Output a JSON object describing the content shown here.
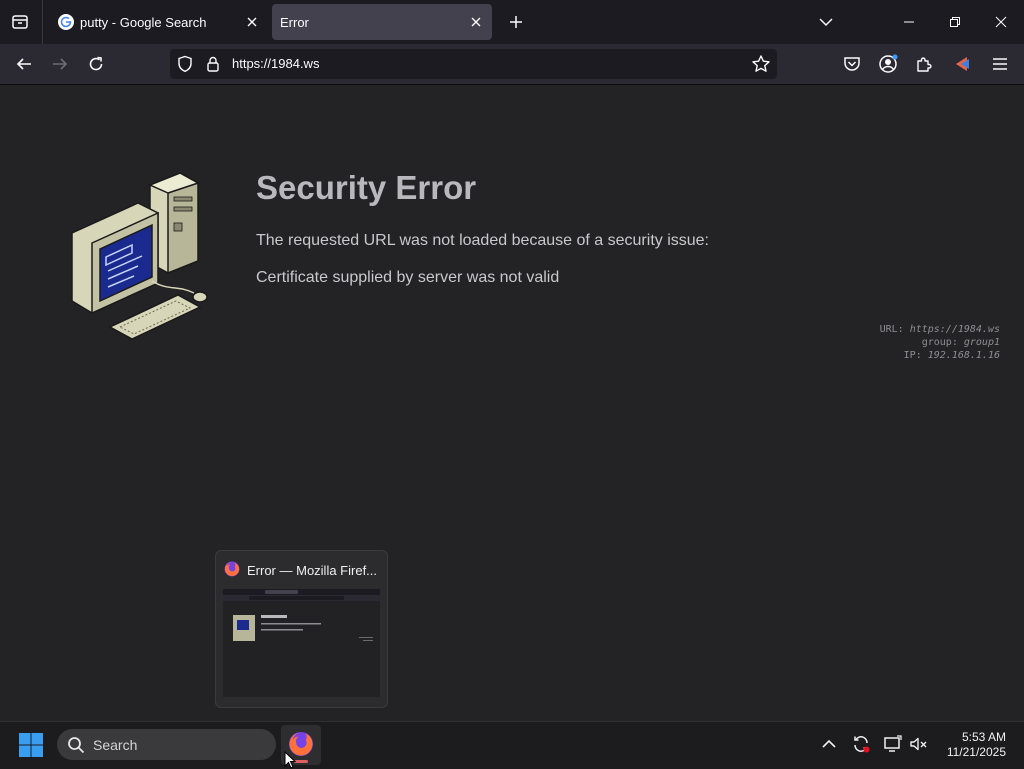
{
  "browser": {
    "tabs": [
      {
        "title": "putty - Google Search",
        "favicon": "google-icon",
        "active": false
      },
      {
        "title": "Error",
        "favicon": "",
        "active": true
      }
    ],
    "url": "https://1984.ws"
  },
  "page": {
    "title": "Security Error",
    "message": "The requested URL was not loaded because of a security issue:",
    "detail": "Certificate supplied by server was not valid",
    "meta": {
      "url_label": "URL:",
      "url_value": "https://1984.ws",
      "group_label": "group:",
      "group_value": "group1",
      "ip_label": "IP:",
      "ip_value": "192.168.1.16"
    }
  },
  "preview": {
    "title": "Error — Mozilla Firef...",
    "thumb_title": "Security Error"
  },
  "taskbar": {
    "search_placeholder": "Search",
    "time": "5:53 AM",
    "date": "11/21/2025"
  },
  "colors": {
    "accent": "#e06060",
    "page_bg": "#232224",
    "toolbar_bg": "#2b2a33",
    "tabstrip_bg": "#1c1b22"
  }
}
